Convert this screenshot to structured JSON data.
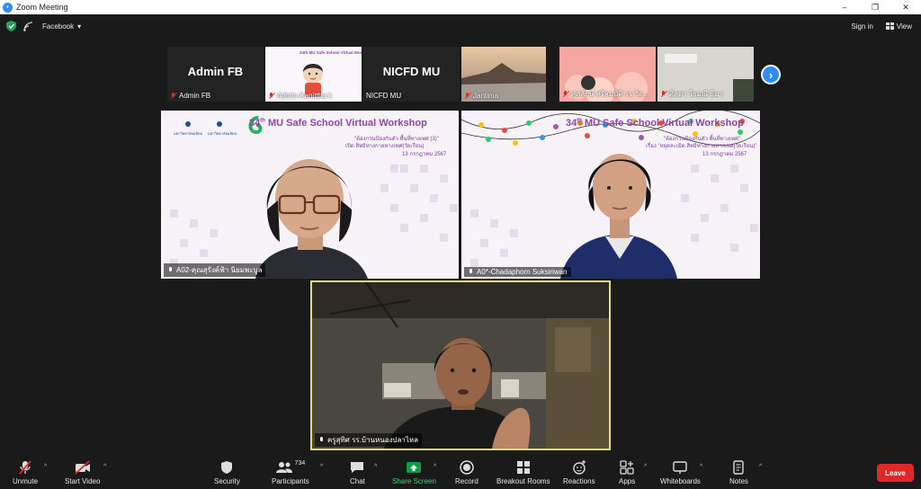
{
  "window": {
    "title": "Zoom Meeting",
    "controls": [
      "–",
      "❐",
      "✕"
    ]
  },
  "topbar": {
    "meeting_name": "Facebook",
    "sign_in": "Sign in",
    "view": "View"
  },
  "strip": [
    {
      "name": "Admin FB",
      "big_name": "Admin FB"
    },
    {
      "name": "Admin-Kanittha k"
    },
    {
      "name": "NICFD MU",
      "big_name": "NICFD MU"
    },
    {
      "name": "Jantima"
    },
    {
      "name": "ศุภลักษ์ ศรีสมบัติ รร.วัด..."
    },
    {
      "name": "ศิลดา ใจมณี ธีมา"
    }
  ],
  "tiles": {
    "t1": {
      "name": "A02-คุณสุรังค์ฟ้า นิยมพะบูล",
      "title_sup": "th",
      "title_num": "34",
      "title": "MU Safe School Virtual Workshop",
      "sub1": "\"ต้องกวนป้องกันตัว พื้นที่ทางเพศ (3)\"",
      "sub2": "เปิด สิทธิทางกายทางเพศ(วัยเรียน)",
      "date": "13 กรกฎาคม 2567"
    },
    "t2": {
      "name": "A0*-Chadaphorn Suksiriwan",
      "title_sup": "th",
      "title_num": "34",
      "title": "MU Safe School Virtual Workshop",
      "sub1": "\"ต้องกวนป้องกันตัว พื้นที่ทางเพศ\"",
      "sub2": "เรื่อง \"หยุดละเมิด สิทธิทางกายทางเพศ(วัยเรียน)\"",
      "date": "13 กรกฎาคม 2567"
    },
    "t3": {
      "name": "ครูสุทิศ รร.บ้านหนองปลาไหล"
    }
  },
  "toolbar": {
    "unmute": "Unmute",
    "start_video": "Start Video",
    "security": "Security",
    "participants": "Participants",
    "participants_count": "734",
    "chat": "Chat",
    "share_screen": "Share Screen",
    "record": "Record",
    "breakout": "Breakout Rooms",
    "reactions": "Reactions",
    "apps": "Apps",
    "whiteboards": "Whiteboards",
    "notes": "Notes",
    "leave": "Leave"
  },
  "colors": {
    "accent": "#2d8cff",
    "leave": "#e02828",
    "share": "#0e9f43",
    "active_speaker": "#e5e06b"
  }
}
